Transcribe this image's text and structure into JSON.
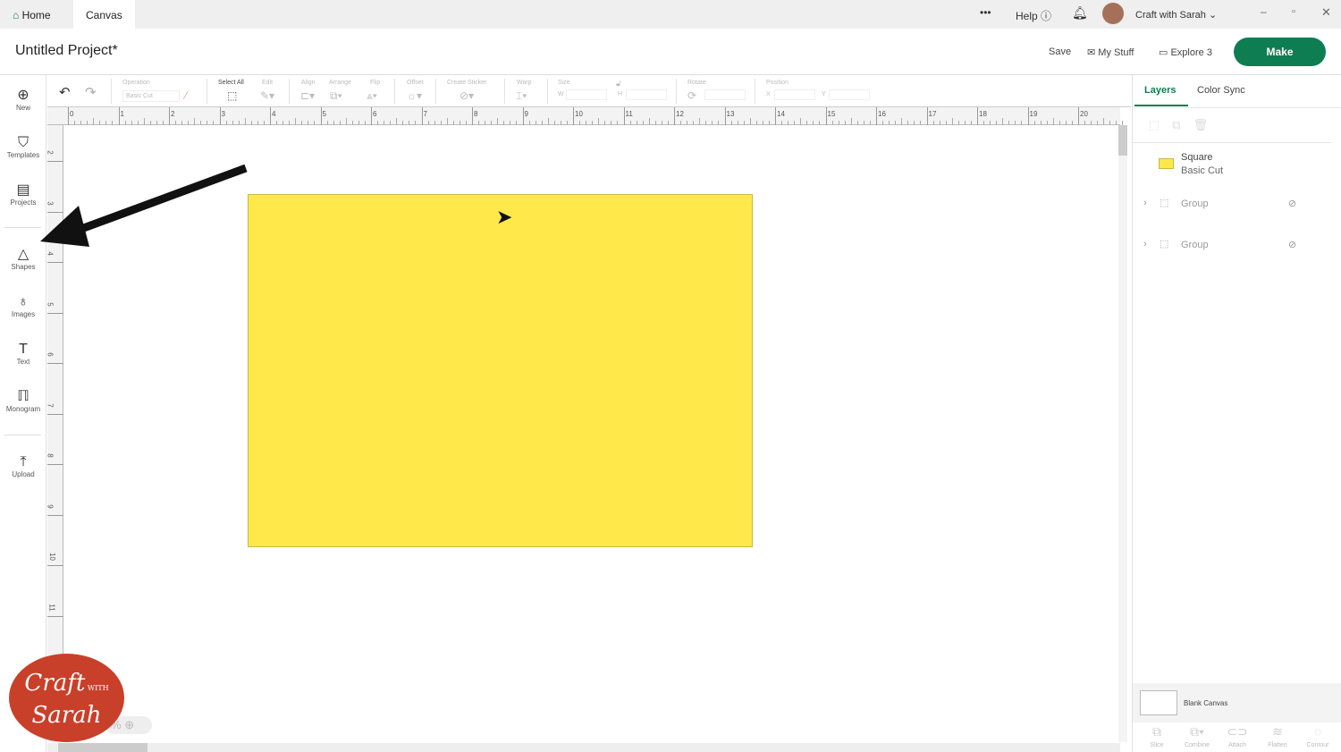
{
  "tabs": [
    {
      "label": "Home"
    },
    {
      "label": "Canvas"
    }
  ],
  "topbar": {
    "more": "•••",
    "help": "Help",
    "user": "Craft with Sarah"
  },
  "header": {
    "title": "Untitled Project*",
    "save": "Save",
    "my_stuff": "My Stuff",
    "machine": "Explore 3",
    "make": "Make"
  },
  "sidebar": [
    {
      "label": "New",
      "icon": "plus-circle-icon"
    },
    {
      "label": "Templates",
      "icon": "shirt-icon"
    },
    {
      "label": "Projects",
      "icon": "clipboard-icon"
    },
    {
      "label": "Shapes",
      "icon": "shapes-icon"
    },
    {
      "label": "Images",
      "icon": "lightbulb-icon"
    },
    {
      "label": "Text",
      "icon": "text-icon"
    },
    {
      "label": "Monogram",
      "icon": "monogram-icon"
    },
    {
      "label": "Upload",
      "icon": "upload-icon"
    }
  ],
  "toolbar": {
    "operation": "Operation",
    "operation_value": "Basic Cut",
    "select_all": "Select All",
    "edit": "Edit",
    "align": "Align",
    "arrange": "Arrange",
    "flip": "Flip",
    "offset": "Offset",
    "create_sticker": "Create Sticker",
    "warp": "Warp",
    "size": "Size",
    "w": "W",
    "h": "H",
    "rotate": "Rotate",
    "position": "Position",
    "x": "X",
    "y": "Y"
  },
  "ruler": {
    "top": [
      "0",
      "1",
      "2",
      "3",
      "4",
      "5",
      "6",
      "7",
      "8",
      "9",
      "10",
      "11",
      "12",
      "13",
      "14",
      "15",
      "16",
      "17",
      "18",
      "19",
      "20"
    ],
    "left": [
      "2",
      "3",
      "4",
      "5",
      "6",
      "7",
      "8",
      "9",
      "10",
      "11"
    ]
  },
  "canvas": {
    "shape_color": "#ffe84a",
    "zoom_text": "%"
  },
  "panel": {
    "tabs": [
      "Layers",
      "Color Sync"
    ],
    "layers": [
      {
        "name": "Square",
        "sub": "Basic Cut",
        "color": "#ffe84a"
      },
      {
        "name": "Group"
      },
      {
        "name": "Group"
      }
    ],
    "blank_canvas": "Blank Canvas",
    "actions": [
      "Slice",
      "Combine",
      "Attach",
      "Flatten",
      "Contour"
    ]
  },
  "watermark": "Craft with Sarah",
  "colors": {
    "accent": "#0f7d52",
    "watermark": "#c8402a"
  }
}
